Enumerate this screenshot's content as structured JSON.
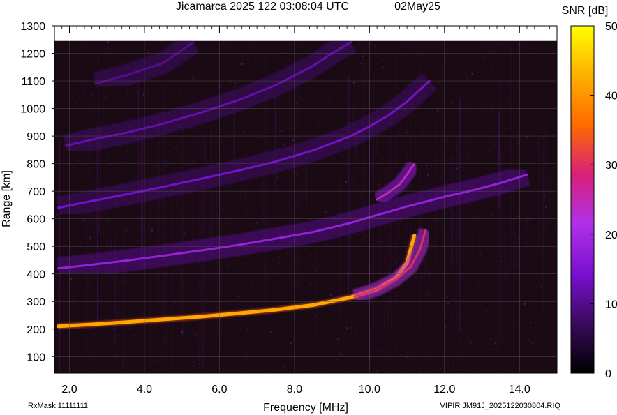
{
  "chart_data": {
    "type": "heatmap",
    "title": "Jicamarca 2025 122 03:08:04 UTC",
    "date_label": "02May25",
    "xlabel": "Frequency [MHz]",
    "ylabel": "Range [km]",
    "xlim": [
      1.6,
      15.0
    ],
    "ylim": [
      40,
      1300
    ],
    "data_range_top": 1245,
    "x_ticks": [
      2.0,
      4.0,
      6.0,
      8.0,
      10.0,
      12.0,
      14.0
    ],
    "x_tick_labels": [
      "2.0",
      "4.0",
      "6.0",
      "8.0",
      "10.0",
      "12.0",
      "14.0"
    ],
    "y_ticks": [
      100,
      200,
      300,
      400,
      500,
      600,
      700,
      800,
      900,
      1000,
      1100,
      1200,
      1300
    ],
    "y_tick_labels": [
      "100",
      "200",
      "300",
      "400",
      "500",
      "600",
      "700",
      "800",
      "900",
      "1000",
      "1100",
      "1200",
      "1300"
    ],
    "colorbar": {
      "label": "SNR [dB]",
      "range": [
        0,
        50
      ],
      "ticks": [
        0,
        10,
        20,
        30,
        40,
        50
      ],
      "tick_labels": [
        "0",
        "10",
        "20",
        "30",
        "40",
        "50"
      ],
      "colors": [
        "#000000",
        "#3a0a5c",
        "#7a10d0",
        "#b030e8",
        "#d8207a",
        "#ff6a00",
        "#ffb000",
        "#ffff00"
      ]
    },
    "grid": true,
    "background_color": "#1a0a14",
    "traces": [
      {
        "x": [
          1.7,
          2.5,
          3.5,
          4.5,
          5.5,
          6.5,
          7.5,
          8.5,
          9.5,
          10.2,
          10.7,
          11.0,
          11.2
        ],
        "y": [
          210,
          216,
          225,
          235,
          245,
          257,
          270,
          287,
          315,
          345,
          385,
          440,
          540
        ],
        "snr": 42
      },
      {
        "x": [
          9.6,
          10.2,
          10.7,
          11.1,
          11.35,
          11.5
        ],
        "y": [
          318,
          345,
          380,
          425,
          490,
          560
        ],
        "snr": 30
      },
      {
        "x": [
          1.7,
          2.5,
          3.5,
          4.5,
          5.5,
          6.5,
          7.5,
          8.5,
          9.5,
          10.0,
          10.5,
          11.0,
          11.5,
          12.0,
          12.5,
          13.0,
          13.5,
          14.2
        ],
        "y": [
          420,
          432,
          448,
          466,
          485,
          505,
          528,
          552,
          585,
          606,
          625,
          645,
          662,
          680,
          695,
          712,
          730,
          760
        ],
        "snr": 18
      },
      {
        "x": [
          1.7,
          2.5,
          3.5,
          4.5,
          5.5,
          6.5,
          7.5,
          8.5,
          9.5,
          10.0,
          10.5,
          11.0,
          11.6
        ],
        "y": [
          640,
          662,
          688,
          716,
          745,
          775,
          808,
          848,
          900,
          935,
          975,
          1025,
          1100
        ],
        "snr": 14
      },
      {
        "x": [
          1.9,
          2.5,
          3.5,
          4.5,
          5.5,
          6.5,
          7.5,
          8.5,
          9.0,
          9.5
        ],
        "y": [
          865,
          884,
          912,
          945,
          985,
          1030,
          1085,
          1155,
          1200,
          1240
        ],
        "snr": 12
      },
      {
        "x": [
          2.7,
          3.5,
          4.5,
          5.3
        ],
        "y": [
          1090,
          1120,
          1165,
          1240
        ],
        "snr": 10
      },
      {
        "x": [
          10.2,
          10.5,
          10.8,
          11.0,
          11.2
        ],
        "y": [
          670,
          695,
          725,
          760,
          800
        ],
        "snr": 25
      }
    ]
  },
  "footer": {
    "rx_mask": "RxMask 11111111",
    "file_label": "VIPIR  JM91J_2025122030804.RIQ"
  }
}
